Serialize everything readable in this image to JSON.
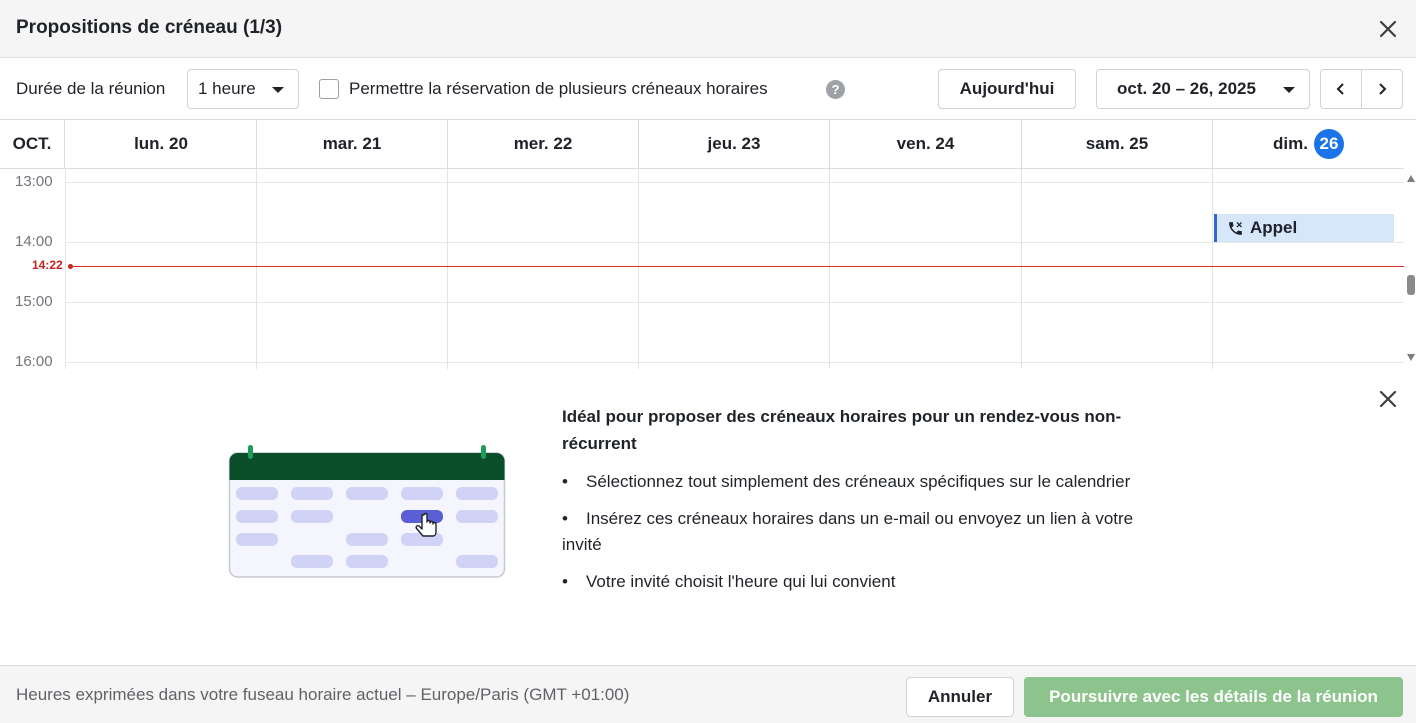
{
  "dialog": {
    "title": "Propositions de créneau (1/3)"
  },
  "toolbar": {
    "duration_label": "Durée de la réunion",
    "duration_value": "1 heure",
    "multi_slot_label": "Permettre la réservation de plusieurs créneaux horaires",
    "multi_slot_checked": false,
    "help_glyph": "?",
    "today_button": "Aujourd'hui",
    "date_range": "oct. 20 – 26, 2025"
  },
  "calendar": {
    "month": "OCT.",
    "days": [
      {
        "label": "lun. 20"
      },
      {
        "label": "mar. 21"
      },
      {
        "label": "mer. 22"
      },
      {
        "label": "jeu. 23"
      },
      {
        "label": "ven. 24"
      },
      {
        "label": "sam. 25"
      },
      {
        "label": "dim.",
        "today_number": "26"
      }
    ],
    "hours": [
      "13:00",
      "14:00",
      "15:00",
      "16:00"
    ],
    "now_label": "14:22",
    "event": {
      "title": "Appel",
      "icon": "phone-icon"
    }
  },
  "info_panel": {
    "title": "Idéal pour proposer des créneaux horaires pour un rendez-vous non-récurrent",
    "bullets": [
      "Sélectionnez tout simplement des créneaux spécifiques sur le calendrier",
      "Insérez ces créneaux horaires dans un e-mail ou envoyez un lien à votre invité",
      "Votre invité choisit l'heure qui lui convient"
    ]
  },
  "footer": {
    "timezone_text": "Heures exprimées dans votre fuseau horaire actuel – Europe/Paris (GMT +01:00)",
    "cancel_button": "Annuler",
    "continue_button": "Poursuivre avec les détails de la réunion"
  },
  "colors": {
    "today_badge": "#1a73e8",
    "now_line": "#d93025",
    "event_bg": "#d6e6fb",
    "event_border": "#3367d6",
    "primary_button": "#8dc48d",
    "illustration_header": "#0b4f2a",
    "illustration_slot": "#d0d2f6",
    "illustration_selected": "#5b5fd6"
  }
}
